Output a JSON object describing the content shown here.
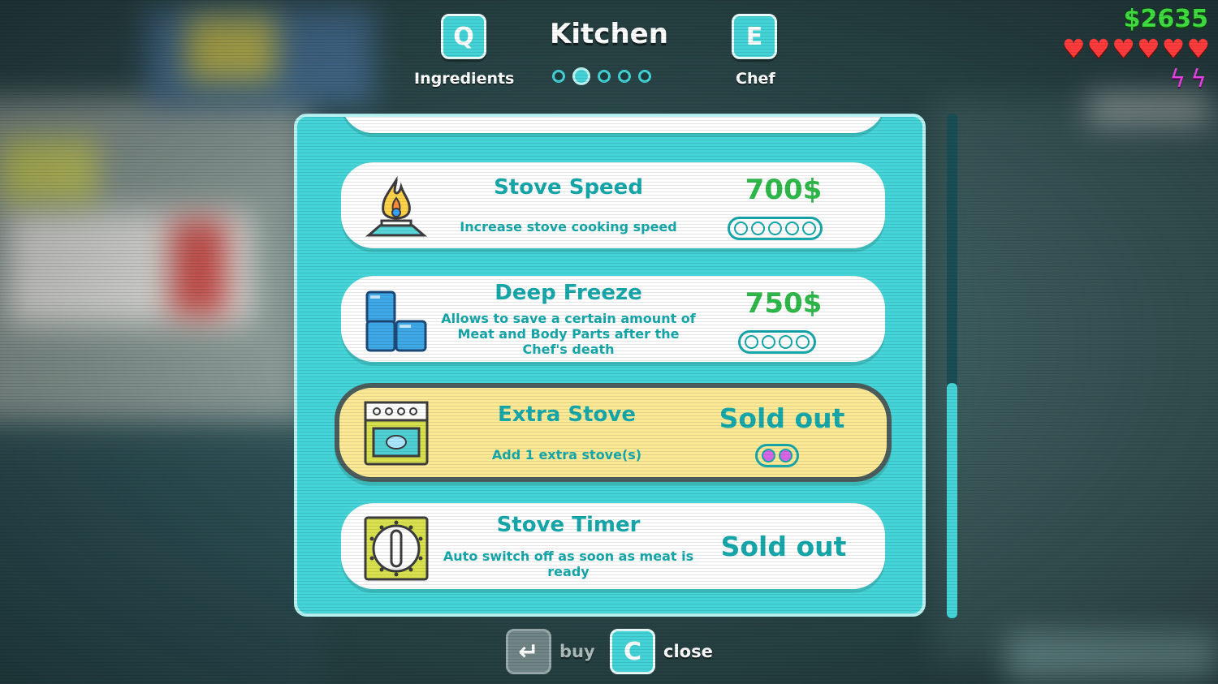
{
  "nav": {
    "prev_key": "Q",
    "prev_label": "Ingredients",
    "title": "Kitchen",
    "next_key": "E",
    "next_label": "Chef",
    "page_count": 5,
    "active_page": 2
  },
  "hud": {
    "money": "$2635",
    "hearts": 6,
    "bolts": 2
  },
  "items": [
    {
      "name": "Stove Speed",
      "description": "Increase stove cooking speed",
      "price": "700$",
      "icon": "stove-flame-icon",
      "levels_total": 5,
      "levels_owned": 0
    },
    {
      "name": "Deep Freeze",
      "description": "Allows to save a certain amount of Meat and Body Parts after the Chef's death",
      "price": "750$",
      "icon": "ice-blocks-icon",
      "levels_total": 4,
      "levels_owned": 0
    },
    {
      "name": "Extra Stove",
      "description": "Add 1 extra stove(s)",
      "status": "Sold out",
      "icon": "oven-icon",
      "levels_total": 2,
      "levels_owned": 2
    },
    {
      "name": "Stove Timer",
      "description": "Auto switch off as soon as meat is ready",
      "status": "Sold out",
      "icon": "timer-dial-icon"
    }
  ],
  "controls": {
    "buy_key": "↵",
    "buy_label": "buy",
    "close_key": "C",
    "close_label": "close"
  },
  "colors": {
    "accent": "#45d5d8",
    "text_teal": "#16a8ab",
    "price_green": "#2eb94a",
    "selected_bg": "#fbe996",
    "money_green": "#3fdc3f",
    "heart_red": "#ff3b3b",
    "bolt_pink": "#e044e0"
  }
}
